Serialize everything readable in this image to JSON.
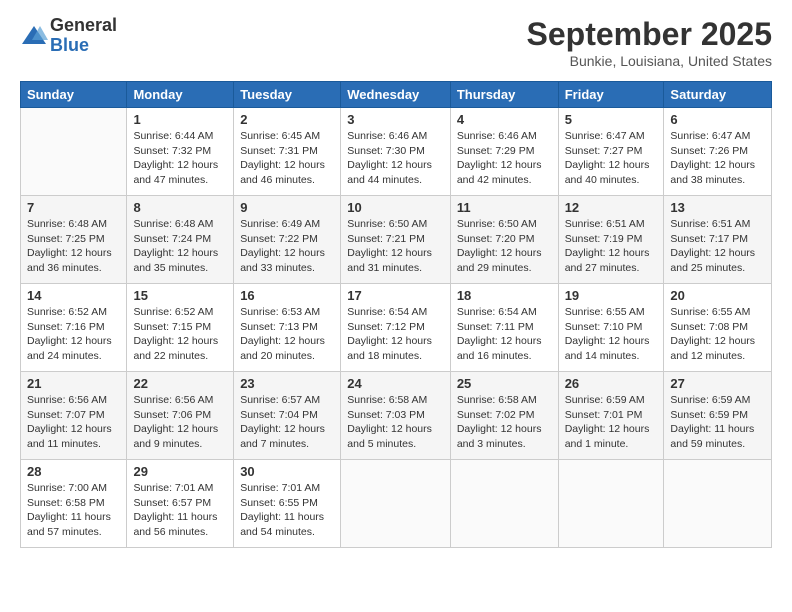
{
  "logo": {
    "general": "General",
    "blue": "Blue"
  },
  "title": "September 2025",
  "location": "Bunkie, Louisiana, United States",
  "weekdays": [
    "Sunday",
    "Monday",
    "Tuesday",
    "Wednesday",
    "Thursday",
    "Friday",
    "Saturday"
  ],
  "weeks": [
    [
      {
        "day": "",
        "info": ""
      },
      {
        "day": "1",
        "info": "Sunrise: 6:44 AM\nSunset: 7:32 PM\nDaylight: 12 hours\nand 47 minutes."
      },
      {
        "day": "2",
        "info": "Sunrise: 6:45 AM\nSunset: 7:31 PM\nDaylight: 12 hours\nand 46 minutes."
      },
      {
        "day": "3",
        "info": "Sunrise: 6:46 AM\nSunset: 7:30 PM\nDaylight: 12 hours\nand 44 minutes."
      },
      {
        "day": "4",
        "info": "Sunrise: 6:46 AM\nSunset: 7:29 PM\nDaylight: 12 hours\nand 42 minutes."
      },
      {
        "day": "5",
        "info": "Sunrise: 6:47 AM\nSunset: 7:27 PM\nDaylight: 12 hours\nand 40 minutes."
      },
      {
        "day": "6",
        "info": "Sunrise: 6:47 AM\nSunset: 7:26 PM\nDaylight: 12 hours\nand 38 minutes."
      }
    ],
    [
      {
        "day": "7",
        "info": "Sunrise: 6:48 AM\nSunset: 7:25 PM\nDaylight: 12 hours\nand 36 minutes."
      },
      {
        "day": "8",
        "info": "Sunrise: 6:48 AM\nSunset: 7:24 PM\nDaylight: 12 hours\nand 35 minutes."
      },
      {
        "day": "9",
        "info": "Sunrise: 6:49 AM\nSunset: 7:22 PM\nDaylight: 12 hours\nand 33 minutes."
      },
      {
        "day": "10",
        "info": "Sunrise: 6:50 AM\nSunset: 7:21 PM\nDaylight: 12 hours\nand 31 minutes."
      },
      {
        "day": "11",
        "info": "Sunrise: 6:50 AM\nSunset: 7:20 PM\nDaylight: 12 hours\nand 29 minutes."
      },
      {
        "day": "12",
        "info": "Sunrise: 6:51 AM\nSunset: 7:19 PM\nDaylight: 12 hours\nand 27 minutes."
      },
      {
        "day": "13",
        "info": "Sunrise: 6:51 AM\nSunset: 7:17 PM\nDaylight: 12 hours\nand 25 minutes."
      }
    ],
    [
      {
        "day": "14",
        "info": "Sunrise: 6:52 AM\nSunset: 7:16 PM\nDaylight: 12 hours\nand 24 minutes."
      },
      {
        "day": "15",
        "info": "Sunrise: 6:52 AM\nSunset: 7:15 PM\nDaylight: 12 hours\nand 22 minutes."
      },
      {
        "day": "16",
        "info": "Sunrise: 6:53 AM\nSunset: 7:13 PM\nDaylight: 12 hours\nand 20 minutes."
      },
      {
        "day": "17",
        "info": "Sunrise: 6:54 AM\nSunset: 7:12 PM\nDaylight: 12 hours\nand 18 minutes."
      },
      {
        "day": "18",
        "info": "Sunrise: 6:54 AM\nSunset: 7:11 PM\nDaylight: 12 hours\nand 16 minutes."
      },
      {
        "day": "19",
        "info": "Sunrise: 6:55 AM\nSunset: 7:10 PM\nDaylight: 12 hours\nand 14 minutes."
      },
      {
        "day": "20",
        "info": "Sunrise: 6:55 AM\nSunset: 7:08 PM\nDaylight: 12 hours\nand 12 minutes."
      }
    ],
    [
      {
        "day": "21",
        "info": "Sunrise: 6:56 AM\nSunset: 7:07 PM\nDaylight: 12 hours\nand 11 minutes."
      },
      {
        "day": "22",
        "info": "Sunrise: 6:56 AM\nSunset: 7:06 PM\nDaylight: 12 hours\nand 9 minutes."
      },
      {
        "day": "23",
        "info": "Sunrise: 6:57 AM\nSunset: 7:04 PM\nDaylight: 12 hours\nand 7 minutes."
      },
      {
        "day": "24",
        "info": "Sunrise: 6:58 AM\nSunset: 7:03 PM\nDaylight: 12 hours\nand 5 minutes."
      },
      {
        "day": "25",
        "info": "Sunrise: 6:58 AM\nSunset: 7:02 PM\nDaylight: 12 hours\nand 3 minutes."
      },
      {
        "day": "26",
        "info": "Sunrise: 6:59 AM\nSunset: 7:01 PM\nDaylight: 12 hours\nand 1 minute."
      },
      {
        "day": "27",
        "info": "Sunrise: 6:59 AM\nSunset: 6:59 PM\nDaylight: 11 hours\nand 59 minutes."
      }
    ],
    [
      {
        "day": "28",
        "info": "Sunrise: 7:00 AM\nSunset: 6:58 PM\nDaylight: 11 hours\nand 57 minutes."
      },
      {
        "day": "29",
        "info": "Sunrise: 7:01 AM\nSunset: 6:57 PM\nDaylight: 11 hours\nand 56 minutes."
      },
      {
        "day": "30",
        "info": "Sunrise: 7:01 AM\nSunset: 6:55 PM\nDaylight: 11 hours\nand 54 minutes."
      },
      {
        "day": "",
        "info": ""
      },
      {
        "day": "",
        "info": ""
      },
      {
        "day": "",
        "info": ""
      },
      {
        "day": "",
        "info": ""
      }
    ]
  ]
}
